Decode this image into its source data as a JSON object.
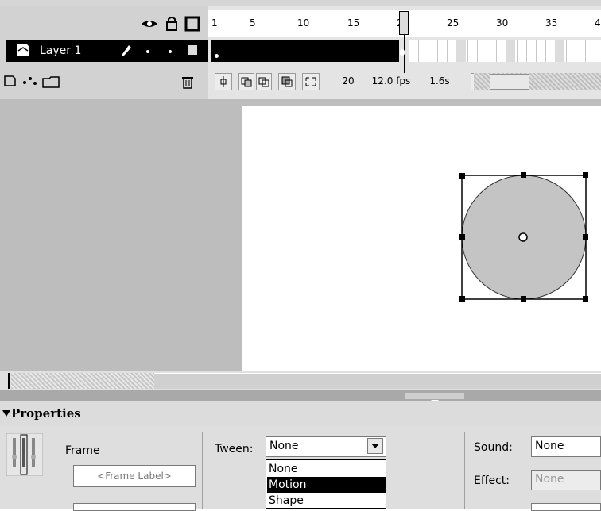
{
  "timeline": {
    "ruler_numbers": [
      "1",
      "5",
      "10",
      "15",
      "20",
      "25",
      "30",
      "35",
      "4"
    ],
    "layer_name": "Layer 1",
    "controls": {
      "current_frame": "20",
      "frame_rate": "12.0 fps",
      "elapsed_time": "1.6s"
    }
  },
  "properties": {
    "title": "Properties",
    "frame_label_title": "Frame",
    "frame_label_placeholder": "<Frame Label>",
    "tween_label": "Tween:",
    "tween_value": "None",
    "tween_options": [
      "None",
      "Motion",
      "Shape"
    ],
    "tween_selected_option": "Motion",
    "sound_label": "Sound:",
    "sound_value": "None",
    "effect_label": "Effect:",
    "effect_value": "None"
  },
  "icons": [
    "eye-icon",
    "lock-icon",
    "outline-square-icon",
    "pencil-icon",
    "trash-icon",
    "add-layer-icon",
    "add-guide-icon",
    "add-folder-icon",
    "onion-skin-icon",
    "edit-multiple-frames-icon"
  ]
}
